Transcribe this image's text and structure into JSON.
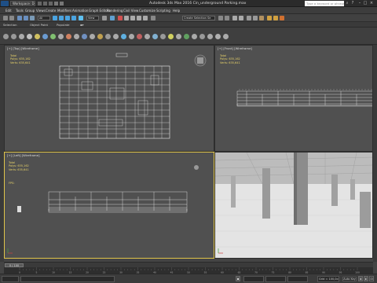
{
  "window": {
    "title": "Autodesk 3ds Max 2016    Cin_underground Parking.max",
    "workspace": "Workspace: Default",
    "search_placeholder": "Type a keyword or phrase"
  },
  "menu": [
    "Edit",
    "Tools",
    "Group",
    "Views",
    "Create",
    "Modifiers",
    "Animation",
    "Graph Editors",
    "Rendering",
    "Civil View",
    "Customize",
    "Scripting",
    "Help"
  ],
  "toolbar": {
    "selection_filter": "All",
    "view_dropdown": "View",
    "named_selection": "Create Selection Se"
  },
  "ribbon_tabs": [
    "Selection",
    "Object Paint",
    "Populate"
  ],
  "viewports": [
    {
      "id": "top",
      "label": "[+] [Top] [Wireframe]",
      "stats": {
        "header": "Total",
        "polys_label": "Polys:",
        "polys": "635,162",
        "verts_label": "Verts:",
        "verts": "635,641"
      }
    },
    {
      "id": "front",
      "label": "[+] [Front] [Wireframe]",
      "stats": {
        "header": "Total",
        "polys_label": "Polys:",
        "polys": "635,162",
        "verts_label": "Verts:",
        "verts": "635,641"
      }
    },
    {
      "id": "left",
      "label": "[+] [Left] [Wireframe]",
      "stats": {
        "header": "Total",
        "polys_label": "Polys:",
        "polys": "635,162",
        "verts_label": "Verts:",
        "verts": "635,641"
      },
      "fps": "FPS:"
    },
    {
      "id": "perspective",
      "label": ""
    }
  ],
  "time_slider": {
    "value": "0 / 100"
  },
  "timeline_ticks": [
    "0",
    "5",
    "10",
    "15",
    "20",
    "25",
    "30",
    "35",
    "40",
    "45",
    "50",
    "55",
    "60",
    "65",
    "70",
    "75",
    "80",
    "85",
    "90",
    "95",
    "100"
  ],
  "status": {
    "grid": "Grid = 100,0cm",
    "add_time_tag": "Add Time Tag",
    "frame": "0",
    "set_key": "Set Key",
    "auto_key": "Auto Key"
  },
  "colors": {
    "accent_yellow": "#e8d36a",
    "active_border": "#e0c44a",
    "app_blue": "#1e4f86"
  }
}
